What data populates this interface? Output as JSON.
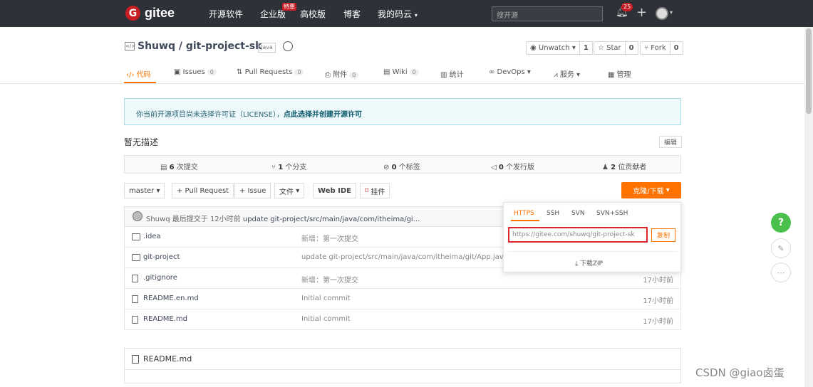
{
  "topbar": {
    "logo_text": "gitee",
    "nav": [
      "开源软件",
      "企业版",
      "高校版",
      "博客",
      "我的码云"
    ],
    "enterprise_tag": "特惠",
    "search_placeholder": "搜开源",
    "notification_count": "25",
    "colors": {
      "bg": "#2e3138",
      "brand": "#c71d23"
    }
  },
  "repo": {
    "owner_repo": "Shuwq / git-project-sk",
    "language": "Java",
    "watch_label": "Unwatch",
    "watch_count": "1",
    "star_label": "Star",
    "star_count": "0",
    "fork_label": "Fork",
    "fork_count": "0"
  },
  "tabs": [
    {
      "label": "代码"
    },
    {
      "label": "Issues",
      "badge": "0"
    },
    {
      "label": "Pull Requests",
      "badge": "0"
    },
    {
      "label": "附件",
      "badge": "0"
    },
    {
      "label": "Wiki",
      "badge": "0"
    },
    {
      "label": "统计"
    },
    {
      "label": "DevOps"
    },
    {
      "label": "服务"
    },
    {
      "label": "管理"
    }
  ],
  "license": {
    "text": "你当前开源项目尚未选择许可证（LICENSE），",
    "link": "点此选择并创建开源许可"
  },
  "description": "暂无描述",
  "edit_label": "编辑",
  "stats": {
    "commits_num": "6",
    "commits_label": "次提交",
    "branches_num": "1",
    "branches_label": "个分支",
    "tags_num": "0",
    "tags_label": "个标签",
    "releases_num": "0",
    "releases_label": "个发行版",
    "contributors_num": "2",
    "contributors_label": "位贡献者"
  },
  "toolbar": {
    "branch": "master",
    "pull_request": "+ Pull Request",
    "issue": "+ Issue",
    "file": "文件",
    "webide": "Web IDE",
    "mount": "挂件",
    "clone": "克隆/下载"
  },
  "commit": {
    "author": "Shuwq",
    "prefix": "最后提交于",
    "time": "12小时前",
    "message": "update git-project/src/main/java/com/itheima/gi..."
  },
  "files": [
    {
      "name": ".idea",
      "msg": "新增：第一次提交",
      "time": ""
    },
    {
      "name": "git-project",
      "msg": "update git-project/src/main/java/com/itheima/git/App.java",
      "time": ""
    },
    {
      "name": ".gitignore",
      "msg": "新增：第一次提交",
      "time": "17小时前"
    },
    {
      "name": "README.en.md",
      "msg": "Initial commit",
      "time": "17小时前"
    },
    {
      "name": "README.md",
      "msg": "Initial commit",
      "time": "17小时前"
    }
  ],
  "readme_title": "README.md",
  "clone_popup": {
    "tabs": [
      "HTTPS",
      "SSH",
      "SVN",
      "SVN+SSH"
    ],
    "url": "https://gitee.com/shuwq/git-project-sk",
    "copy": "复制",
    "download_zip": "下载ZIP"
  },
  "floating": {
    "help": "?"
  },
  "watermark": "CSDN @giao卤蛋"
}
